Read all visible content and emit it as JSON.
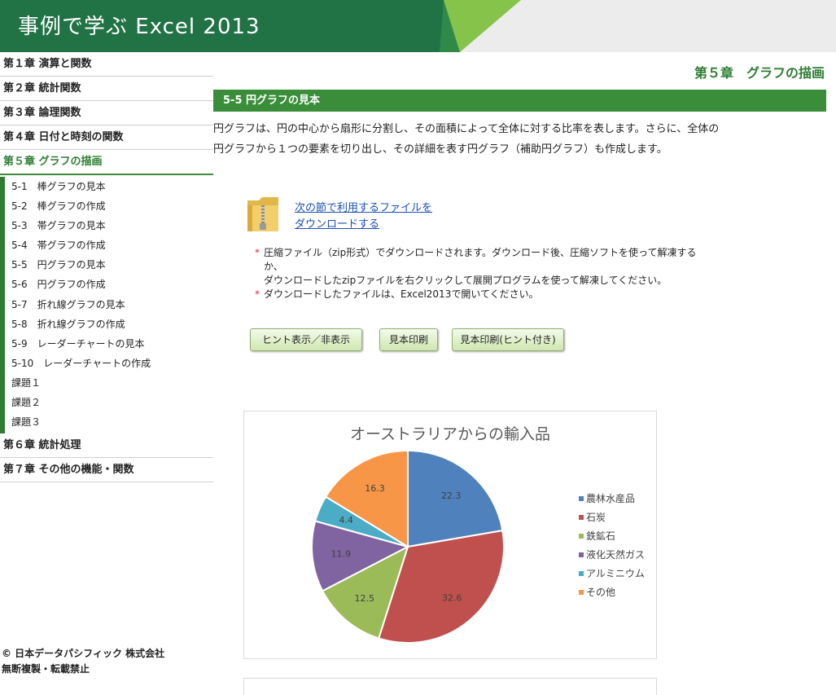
{
  "header": {
    "title": "事例で学ぶ Excel 2013"
  },
  "sidebar": {
    "chapters_before": [
      "第１章 演算と関数",
      "第２章 統計関数",
      "第３章 論理関数",
      "第４章 日付と時刻の関数"
    ],
    "active_chapter": "第５章 グラフの描画",
    "subitems": [
      "5-1　棒グラフの見本",
      "5-2　棒グラフの作成",
      "5-3　帯グラフの見本",
      "5-4　帯グラフの作成",
      "5-5　円グラフの見本",
      "5-6　円グラフの作成",
      "5-7　折れ線グラフの見本",
      "5-8　折れ線グラフの作成",
      "5-9　レーダーチャートの見本",
      "5-10　レーダーチャートの作成",
      "課題１",
      "課題２",
      "課題３"
    ],
    "chapters_after": [
      "第６章 統計処理",
      "第７章 その他の機能・関数"
    ],
    "copyright_line1": "© 日本データパシフィック 株式会社",
    "copyright_line2": "無断複製・転載禁止"
  },
  "main": {
    "chapter_heading": "第５章　グラフの描画",
    "section_title": "5-5  円グラフの見本",
    "intro_line1": "円グラフは、円の中心から扇形に分割し、その面積によって全体に対する比率を表します。さらに、全体の",
    "intro_line2": "円グラフから１つの要素を切り出し、その詳細を表す円グラフ（補助円グラフ）も作成します。",
    "download_line1": "次の節で利用するファイルを",
    "download_line2": "ダウンロードする",
    "note_star": "*",
    "note1_line1": "圧縮ファイル（zip形式）でダウンロードされます。ダウンロード後、圧縮ソフトを使って解凍する",
    "note1_line2": "か、",
    "note1_line3": "ダウンロードしたzipファイルを右クリックして展開プログラムを使って解凍してください。",
    "note2": "ダウンロードしたファイルは、Excel2013で開いてください。",
    "buttons": {
      "hint_toggle": "ヒント表示／非表示",
      "print_sample": "見本印刷",
      "print_with_hint": "見本印刷(ヒント付き)"
    }
  },
  "chart_data": {
    "type": "pie",
    "title": "オーストラリアからの輸入品",
    "categories": [
      "農林水産品",
      "石炭",
      "鉄鉱石",
      "液化天然ガス",
      "アルミニウム",
      "その他"
    ],
    "values": [
      22.3,
      32.6,
      12.5,
      11.9,
      4.4,
      16.3
    ],
    "colors": [
      "#4f81bd",
      "#c0504d",
      "#9bbb59",
      "#8064a2",
      "#4bacc6",
      "#f79646"
    ],
    "legend_position": "right",
    "data_labels": true
  },
  "colors": {
    "brand_green": "#2e7d32",
    "section_green": "#3a8e3a",
    "link_blue": "#1a4fb5",
    "note_star_red": "#e23"
  },
  "icons": {
    "download": "zip-folder-icon"
  }
}
